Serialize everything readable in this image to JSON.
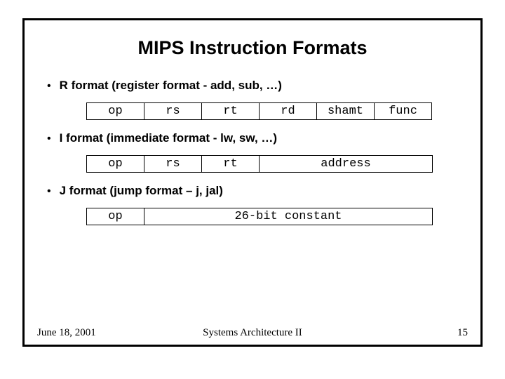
{
  "title": "MIPS Instruction Formats",
  "bullets": {
    "r": "R format (register format - add, sub, …)",
    "i": "I format (immediate format - lw, sw, …)",
    "j": "J format (jump format – j, jal)"
  },
  "r_format": {
    "op": "op",
    "rs": "rs",
    "rt": "rt",
    "rd": "rd",
    "shamt": "shamt",
    "func": "func"
  },
  "i_format": {
    "op": "op",
    "rs": "rs",
    "rt": "rt",
    "address": "address"
  },
  "j_format": {
    "op": "op",
    "constant": "26-bit constant"
  },
  "footer": {
    "date": "June 18, 2001",
    "course": "Systems Architecture II",
    "page": "15"
  }
}
